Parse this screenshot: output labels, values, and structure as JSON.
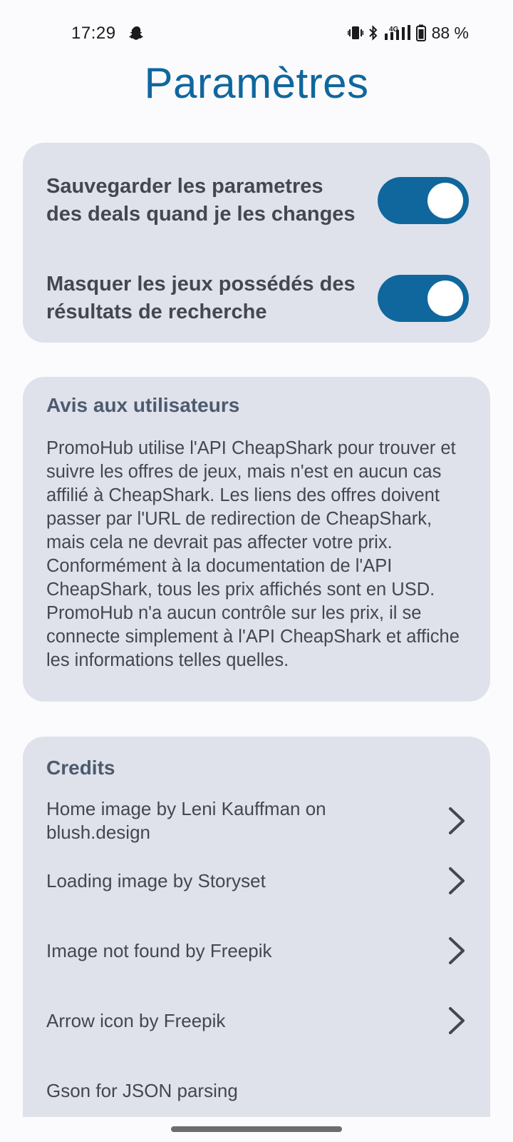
{
  "status_bar": {
    "time": "17:29",
    "battery": "88 %",
    "icons": [
      "snapchat-icon",
      "vibrate-icon",
      "bluetooth-icon",
      "signal-4g-icon",
      "battery-icon"
    ]
  },
  "page": {
    "title": "Paramètres"
  },
  "settings": {
    "items": [
      {
        "label": "Sauvegarder les parametres des deals quand je les changes",
        "enabled": true
      },
      {
        "label": "Masquer les jeux possédés des résultats de recherche",
        "enabled": true
      }
    ]
  },
  "notice": {
    "heading": "Avis aux utilisateurs",
    "body": "PromoHub utilise l'API CheapShark pour trouver et suivre les offres de jeux, mais n'est en aucun cas affilié à CheapShark. Les liens des offres doivent passer par l'URL de redirection de CheapShark, mais cela ne devrait pas affecter votre prix. Conformément à la documentation de l'API CheapShark, tous les prix affichés sont en USD. PromoHub n'a aucun contrôle sur les prix, il se connecte simplement à l'API CheapShark et affiche les informations telles quelles."
  },
  "credits": {
    "heading": "Credits",
    "items": [
      {
        "label": "Home image by Leni Kauffman on blush.design"
      },
      {
        "label": "Loading image by Storyset"
      },
      {
        "label": "Image not found by Freepik"
      },
      {
        "label": "Arrow icon by Freepik"
      },
      {
        "label": "Gson for JSON parsing"
      }
    ]
  },
  "colors": {
    "accent": "#0f679e",
    "card": "#dfe2eb",
    "background": "#fbfbfe"
  }
}
